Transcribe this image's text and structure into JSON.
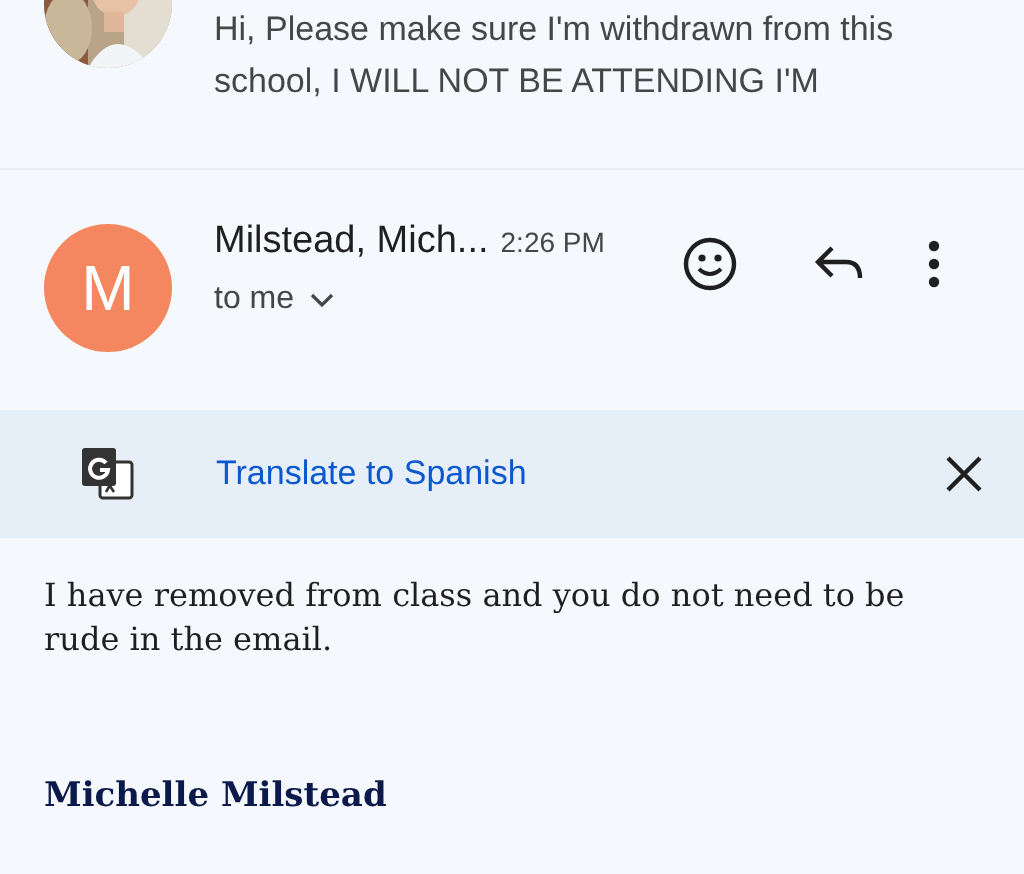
{
  "previous_message": {
    "snippet": "Hi, Please make sure I'm withdrawn from this school, I WILL NOT BE ATTENDING I'M"
  },
  "message": {
    "sender_initial": "M",
    "sender": "Milstead, Mich...",
    "time": "2:26 PM",
    "recipient": "to me"
  },
  "translate_bar": {
    "label": "Translate to Spanish"
  },
  "body": {
    "paragraphs": [
      "I have removed from class and you do not need to be rude in the email."
    ],
    "signature_name": "Michelle Milstead"
  }
}
